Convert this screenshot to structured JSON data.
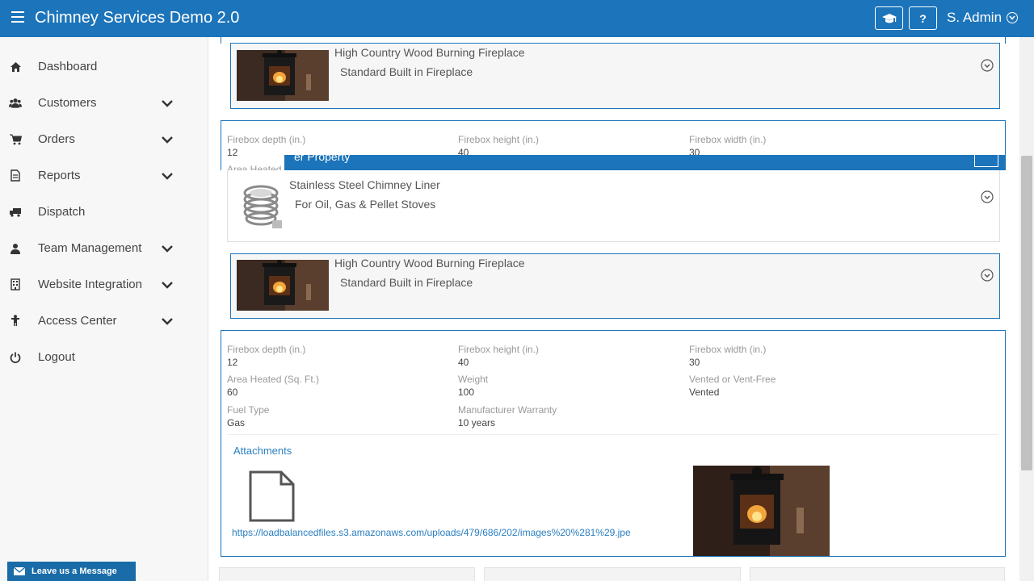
{
  "app": {
    "title": "Chimney Services Demo 2.0"
  },
  "header": {
    "user_label": "S. Admin",
    "help_label": "?"
  },
  "sidebar": {
    "items": [
      {
        "label": "Dashboard",
        "icon": "home-icon",
        "expandable": false
      },
      {
        "label": "Customers",
        "icon": "users-icon",
        "expandable": true
      },
      {
        "label": "Orders",
        "icon": "cart-icon",
        "expandable": true
      },
      {
        "label": "Reports",
        "icon": "document-icon",
        "expandable": true
      },
      {
        "label": "Dispatch",
        "icon": "truck-icon",
        "expandable": false
      },
      {
        "label": "Team Management",
        "icon": "user-icon",
        "expandable": true
      },
      {
        "label": "Website Integration",
        "icon": "building-icon",
        "expandable": true
      },
      {
        "label": "Access Center",
        "icon": "person-icon",
        "expandable": true
      },
      {
        "label": "Logout",
        "icon": "power-icon",
        "expandable": false
      }
    ]
  },
  "products": [
    {
      "title": "High Country Wood Burning Fireplace",
      "subtitle": "Standard Built in Fireplace"
    },
    {
      "title": "Stainless Steel Chimney Liner",
      "subtitle": "For Oil, Gas & Pellet Stoves"
    },
    {
      "title": "High Country Wood Burning Fireplace",
      "subtitle": "Standard Built in Fireplace"
    }
  ],
  "overlay": {
    "band_text": "er Property"
  },
  "partial_details": {
    "depth_label": "Firebox depth (in.)",
    "depth_value": "12",
    "height_label": "Firebox height (in.)",
    "height_value": "40",
    "width_label": "Firebox width (in.)",
    "width_value": "30",
    "area_label": "Area Heated"
  },
  "details": {
    "depth_label": "Firebox depth (in.)",
    "depth_value": "12",
    "height_label": "Firebox height (in.)",
    "height_value": "40",
    "width_label": "Firebox width (in.)",
    "width_value": "30",
    "area_label": "Area Heated (Sq. Ft.)",
    "area_value": "60",
    "weight_label": "Weight",
    "weight_value": "100",
    "vent_label": "Vented or Vent-Free",
    "vent_value": "Vented",
    "fuel_label": "Fuel Type",
    "fuel_value": "Gas",
    "warranty_label": "Manufacturer Warranty",
    "warranty_value": "10 years",
    "attachments_title": "Attachments",
    "attachment_url": "https://loadbalancedfiles.s3.amazonaws.com/uploads/479/686/202/images%20%281%29.jpe"
  },
  "chat": {
    "label": "Leave us a Message"
  },
  "colors": {
    "primary": "#1c74ba",
    "sidebar_bg": "#f7f7f7",
    "link": "#2a7fc1"
  }
}
